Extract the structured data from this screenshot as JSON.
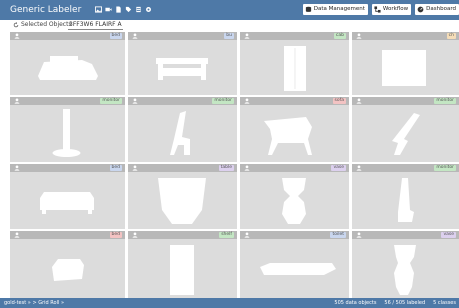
{
  "header": {
    "title": "Generic Labeler",
    "toolbar_icons": [
      "image-icon",
      "video-icon",
      "document-icon",
      "tag-icon",
      "file-icon",
      "settings-icon"
    ],
    "buttons": [
      {
        "label": "Data Management",
        "icon": "database-icon"
      },
      {
        "label": "Workflow",
        "icon": "workflow-icon"
      },
      {
        "label": "Dashboard",
        "icon": "dashboard-icon"
      }
    ]
  },
  "subbar": {
    "scheme_label": "Selected Objects",
    "scheme_value": "3FF3W6 FLAIRF A"
  },
  "colors": {
    "header_bg": "#4e79a7",
    "card_bg": "#dcdcdc",
    "card_head_bg": "#b8b8b8",
    "badge_blue": "#c9d6ee",
    "badge_green": "#c3e6c3",
    "badge_red": "#f3c3c3",
    "badge_purple": "#dcd0ee",
    "badge_orange": "#f5ddb8"
  },
  "cards": [
    {
      "badge": "bed",
      "color": "#c9d6ee",
      "shape": "bed"
    },
    {
      "badge": "bu",
      "color": "#c9d6ee",
      "shape": "bench"
    },
    {
      "badge": "cab",
      "color": "#c3e6c3",
      "shape": "cabinet"
    },
    {
      "badge": "ch",
      "color": "#f5ddb8",
      "shape": "box"
    },
    {
      "badge": "monitor",
      "color": "#c3e6c3",
      "shape": "lamp"
    },
    {
      "badge": "monitor",
      "color": "#c3e6c3",
      "shape": "chair-side"
    },
    {
      "badge": "sofa",
      "color": "#f3c3c3",
      "shape": "armchair"
    },
    {
      "badge": "monitor",
      "color": "#c3e6c3",
      "shape": "chair-side-2"
    },
    {
      "badge": "bed",
      "color": "#c9d6ee",
      "shape": "sofa"
    },
    {
      "badge": "table",
      "color": "#dcd0ee",
      "shape": "pot"
    },
    {
      "badge": "vase",
      "color": "#dcd0ee",
      "shape": "vase"
    },
    {
      "badge": "monitor",
      "color": "#c3e6c3",
      "shape": "chair-tall"
    },
    {
      "badge": "bed",
      "color": "#f3c3c3",
      "shape": "small-sofa"
    },
    {
      "badge": "shelf",
      "color": "#c3e6c3",
      "shape": "tall-cabinet"
    },
    {
      "badge": "toilet",
      "color": "#c9d6ee",
      "shape": "long-bench"
    },
    {
      "badge": "vase",
      "color": "#dcd0ee",
      "shape": "vase-2"
    }
  ],
  "footer": {
    "breadcrumb": "gold-test » > Grid Roll »",
    "data_count": "505 data objects",
    "labeled": "56 / 505 labeled",
    "classes": "5 classes"
  }
}
